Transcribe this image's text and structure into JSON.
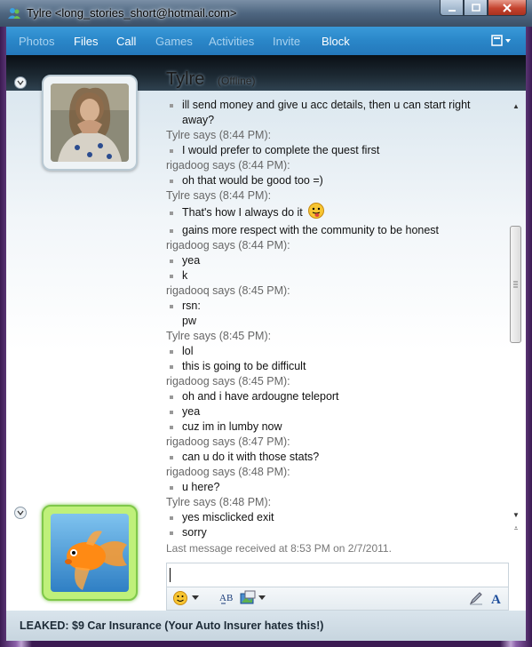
{
  "window": {
    "title": "Tylre <long_stories_short@hotmail.com>"
  },
  "menu": {
    "items": [
      {
        "label": "Photos",
        "active": false
      },
      {
        "label": "Files",
        "active": true
      },
      {
        "label": "Call",
        "active": true
      },
      {
        "label": "Games",
        "active": false
      },
      {
        "label": "Activities",
        "active": false
      },
      {
        "label": "Invite",
        "active": false
      },
      {
        "label": "Block",
        "active": true
      }
    ]
  },
  "contact": {
    "name": "Tylre",
    "status": "(Offline)"
  },
  "conversation": [
    {
      "type": "msg",
      "text": "ill send money and give u acc details, then u can start right"
    },
    {
      "type": "msg-cont",
      "text": "away?"
    },
    {
      "type": "sender",
      "text": "Tylre says (8:44 PM):"
    },
    {
      "type": "msg",
      "text": "I would prefer to complete the quest first"
    },
    {
      "type": "sender",
      "text": "rigadoog says (8:44 PM):"
    },
    {
      "type": "msg",
      "text": "oh that would be good too =)"
    },
    {
      "type": "sender",
      "text": "Tylre says (8:44 PM):"
    },
    {
      "type": "msg",
      "text": "That's how I always do it"
    },
    {
      "type": "msg",
      "text": "gains more respect with the community to be honest"
    },
    {
      "type": "sender",
      "text": "rigadoog says (8:44 PM):"
    },
    {
      "type": "msg",
      "text": "yea"
    },
    {
      "type": "msg",
      "text": "k"
    },
    {
      "type": "sender",
      "text": "rigadooq says (8:45 PM):"
    },
    {
      "type": "msg",
      "text": "rsn:"
    },
    {
      "type": "msg-cont",
      "text": "pw"
    },
    {
      "type": "sender",
      "text": "Tylre says (8:45 PM):"
    },
    {
      "type": "msg",
      "text": "lol"
    },
    {
      "type": "msg",
      "text": "this is going to be difficult"
    },
    {
      "type": "sender",
      "text": "rigadoog says (8:45 PM):"
    },
    {
      "type": "msg",
      "text": "oh and i have ardougne teleport"
    },
    {
      "type": "msg",
      "text": "yea"
    },
    {
      "type": "msg",
      "text": "cuz im in lumby now"
    },
    {
      "type": "sender",
      "text": "rigadoog says (8:47 PM):"
    },
    {
      "type": "msg",
      "text": "can u do it with those stats?"
    },
    {
      "type": "sender",
      "text": "rigadoog says (8:48 PM):"
    },
    {
      "type": "msg",
      "text": "u here?"
    },
    {
      "type": "sender",
      "text": "Tylre says (8:48 PM):"
    },
    {
      "type": "msg",
      "text": "yes misclicked exit"
    },
    {
      "type": "msg",
      "text": "sorry"
    },
    {
      "type": "last",
      "text": "Last message received at 8:53 PM on 2/7/2011."
    }
  ],
  "input": {
    "value": ""
  },
  "ad": {
    "text": "LEAKED: $9 Car Insurance (Your Auto Insurer hates this!)"
  },
  "colors": {
    "menu_bar": "#2a86c8",
    "my_frame": "#7fc84a"
  }
}
